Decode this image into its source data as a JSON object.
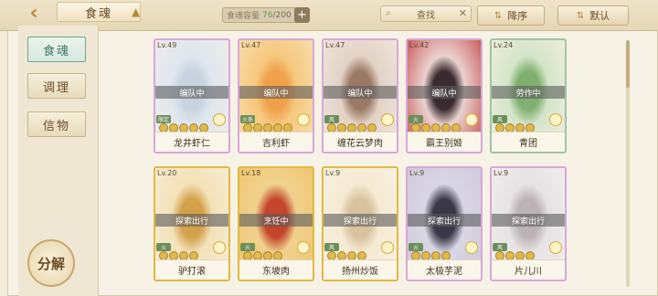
{
  "header": {
    "title": "食魂",
    "capacity_label": "食魂容量",
    "capacity_current": "76",
    "capacity_total": "/200",
    "search_placeholder": "查找",
    "sort_desc_label": "降序",
    "sort_default_label": "默认",
    "accent_color": "#b7873b"
  },
  "sidebar": {
    "tabs": [
      {
        "label": "食魂",
        "active": true
      },
      {
        "label": "调理",
        "active": false
      },
      {
        "label": "信物",
        "active": false
      }
    ],
    "decompose_label": "分解"
  },
  "cards": [
    {
      "level": "Lv.49",
      "status": "编队中",
      "badge": "限定",
      "name": "龙井虾仁",
      "frame": "rainbow",
      "stars": 5,
      "art": [
        "#dfe7ee",
        "#c7d4df",
        "#f1ece8"
      ]
    },
    {
      "level": "Lv.47",
      "status": "编队中",
      "badge": "火系",
      "name": "吉利虾",
      "frame": "rainbow",
      "stars": 5,
      "art": [
        "#f6c87e",
        "#f0a04a",
        "#f6e0b1"
      ]
    },
    {
      "level": "Lv.47",
      "status": "编队中",
      "badge": "风",
      "name": "缠花云梦肉",
      "frame": "rainbow",
      "stars": 5,
      "art": [
        "#e3d3c7",
        "#9b7a65",
        "#f1e6dc"
      ]
    },
    {
      "level": "Lv.42",
      "status": "编队中",
      "badge": "火",
      "name": "霸王别姬",
      "frame": "rainbow",
      "stars": 5,
      "art": [
        "#ead2cf",
        "#3a2b31",
        "#c44b4b"
      ]
    },
    {
      "level": "Lv.24",
      "status": "劳作中",
      "badge": "风",
      "name": "青团",
      "frame": "green",
      "stars": 4,
      "art": [
        "#d4e5c9",
        "#7fb070",
        "#f2efe0"
      ]
    },
    {
      "level": "Lv.20",
      "status": "探索出行",
      "badge": "火",
      "name": "驴打滚",
      "frame": "gold",
      "stars": 4,
      "art": [
        "#f3e2b8",
        "#d4a14b",
        "#f6eed8"
      ]
    },
    {
      "level": "Lv.18",
      "status": "烹饪中",
      "badge": "火",
      "name": "东坡肉",
      "frame": "gold",
      "stars": 4,
      "art": [
        "#f0d28e",
        "#c3452c",
        "#efc46c"
      ]
    },
    {
      "level": "Lv.9",
      "status": "探索出行",
      "badge": "风",
      "name": "扬州炒饭",
      "frame": "gold",
      "stars": 4,
      "art": [
        "#f5ead2",
        "#d8c39e",
        "#f7f1e4"
      ]
    },
    {
      "level": "Lv.9",
      "status": "探索出行",
      "badge": "火",
      "name": "太极芋泥",
      "frame": "rainbow",
      "stars": 4,
      "art": [
        "#d9d6e6",
        "#3a3847",
        "#cfc8d8"
      ]
    },
    {
      "level": "Lv.9",
      "status": "探索出行",
      "badge": "风",
      "name": "片儿川",
      "frame": "rainbow",
      "stars": 4,
      "art": [
        "#e7e3e5",
        "#bdb3b6",
        "#f3eff0"
      ]
    }
  ]
}
